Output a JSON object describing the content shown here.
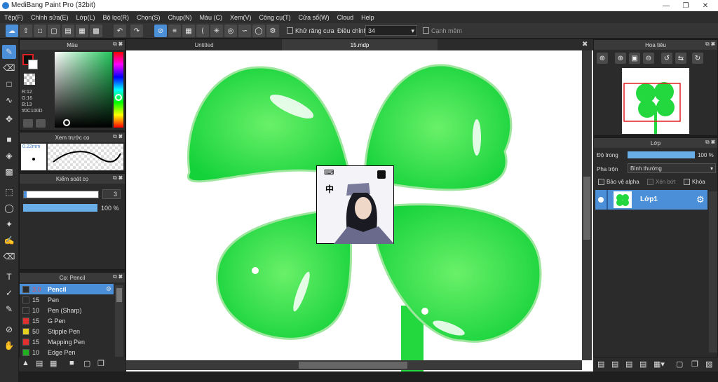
{
  "app": {
    "title": "MediBang Paint Pro (32bit)"
  },
  "menu": [
    "Tệp(F)",
    "Chỉnh sửa(E)",
    "Lớp(L)",
    "Bộ lọc(R)",
    "Chọn(S)",
    "Chụp(N)",
    "Màu (C)",
    "Xem(V)",
    "Công cụ(T)",
    "Cửa sổ(W)",
    "Cloud",
    "Help"
  ],
  "toolbar": {
    "antialias_label": "Khử răng cưa",
    "adjust_label": "Điều chỉnh",
    "adjust_value": "34",
    "snap_label": "Cạnh mềm"
  },
  "color_panel": {
    "title": "Màu",
    "r": "R:12",
    "g": "G:16",
    "b": "B:13",
    "hex": "#0C100D"
  },
  "brush_preview": {
    "title": "Xem trước cọ",
    "size": "0.22mm"
  },
  "brush_control": {
    "title": "Kiểm soát cọ",
    "size_value": "3",
    "opacity_value": "100 %"
  },
  "brush_list": {
    "title": "Cọ: Pencil",
    "items": [
      {
        "size": "3.0",
        "name": "Pencil",
        "color": "#2b2b2b",
        "selected": true
      },
      {
        "size": "15",
        "name": "Pen",
        "color": "#2b2b2b"
      },
      {
        "size": "10",
        "name": "Pen (Sharp)",
        "color": "#2b2b2b"
      },
      {
        "size": "15",
        "name": "G Pen",
        "color": "#e03030"
      },
      {
        "size": "50",
        "name": "Stipple Pen",
        "color": "#e8d020"
      },
      {
        "size": "15",
        "name": "Mapping Pen",
        "color": "#e03030"
      },
      {
        "size": "10",
        "name": "Edge Pen",
        "color": "#20b020"
      }
    ]
  },
  "tabs": {
    "tab1": "Untitled",
    "tab2": "15.mdp"
  },
  "navigator": {
    "title": "Hoa tiêu"
  },
  "layer_panel": {
    "title": "Lớp",
    "opacity_label": "Độ trong",
    "opacity_value": "100 %",
    "blend_label": "Pha trộn",
    "blend_value": "Bình thường",
    "protect_alpha": "Bảo vệ alpha",
    "clipping": "Xén bớt",
    "lock": "Khóa",
    "layer_name": "Lớp1"
  },
  "overlay": {
    "glyph": "中"
  },
  "colors": {
    "accent": "#4a8fd8",
    "clover": "#22e040",
    "bg": "#2b2b2b"
  }
}
